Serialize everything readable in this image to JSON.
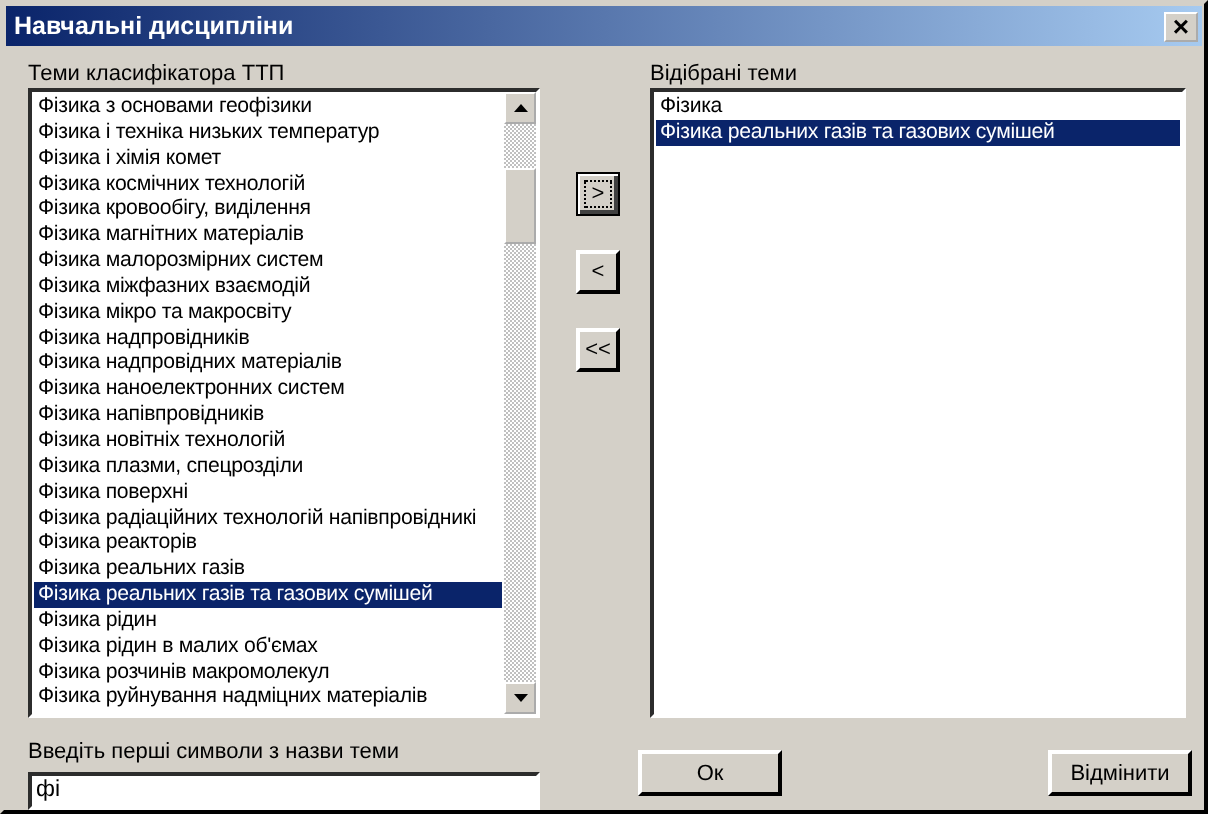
{
  "window": {
    "title": "Навчальні дисципліни",
    "close": "×"
  },
  "source_list": {
    "label": "Теми класифікатора ТТП",
    "items": [
      {
        "text": "Фізика з основами геофізики",
        "selected": false
      },
      {
        "text": "Фізика і техніка низьких температур",
        "selected": false
      },
      {
        "text": "Фізика і хімія комет",
        "selected": false
      },
      {
        "text": "Фізика космічних технологій",
        "selected": false
      },
      {
        "text": "Фізика кровообігу, виділення",
        "selected": false
      },
      {
        "text": "Фізика магнітних матеріалів",
        "selected": false
      },
      {
        "text": "Фізика малорозмірних систем",
        "selected": false
      },
      {
        "text": "Фізика міжфазних взаємодій",
        "selected": false
      },
      {
        "text": "Фізика мікро та макросвіту",
        "selected": false
      },
      {
        "text": "Фізика надпровідників",
        "selected": false
      },
      {
        "text": "Фізика надпровідних матеріалів",
        "selected": false
      },
      {
        "text": "Фізика наноелектронних систем",
        "selected": false
      },
      {
        "text": "Фізика напівпровідників",
        "selected": false
      },
      {
        "text": "Фізика новітніх технологій",
        "selected": false
      },
      {
        "text": "Фізика плазми, спецрозділи",
        "selected": false
      },
      {
        "text": "Фізика поверхні",
        "selected": false
      },
      {
        "text": "Фізика радіаційних технологій напівпровідникі",
        "selected": false
      },
      {
        "text": "Фізика реакторів",
        "selected": false
      },
      {
        "text": "Фізика реальних газів",
        "selected": false
      },
      {
        "text": "Фізика реальних газів та газових сумішей",
        "selected": true
      },
      {
        "text": "Фізика рідин",
        "selected": false
      },
      {
        "text": "Фізика рідин в малих об'ємах",
        "selected": false
      },
      {
        "text": "Фізика розчинів макромолекул",
        "selected": false
      },
      {
        "text": "Фізика руйнування надміцних матеріалів",
        "selected": false
      }
    ]
  },
  "move_buttons": [
    {
      "label": ">",
      "focused": true
    },
    {
      "label": "<",
      "focused": false
    },
    {
      "label": "<<",
      "focused": false
    }
  ],
  "selected_list": {
    "label": "Відібрані теми",
    "items": [
      {
        "text": "Фізика",
        "selected": false
      },
      {
        "text": "Фізика реальних газів та газових сумішей",
        "selected": true
      }
    ]
  },
  "search": {
    "label": "Введіть перші символи з назви теми",
    "value": "фі"
  },
  "buttons": [
    "Ок",
    "Відмінити"
  ]
}
